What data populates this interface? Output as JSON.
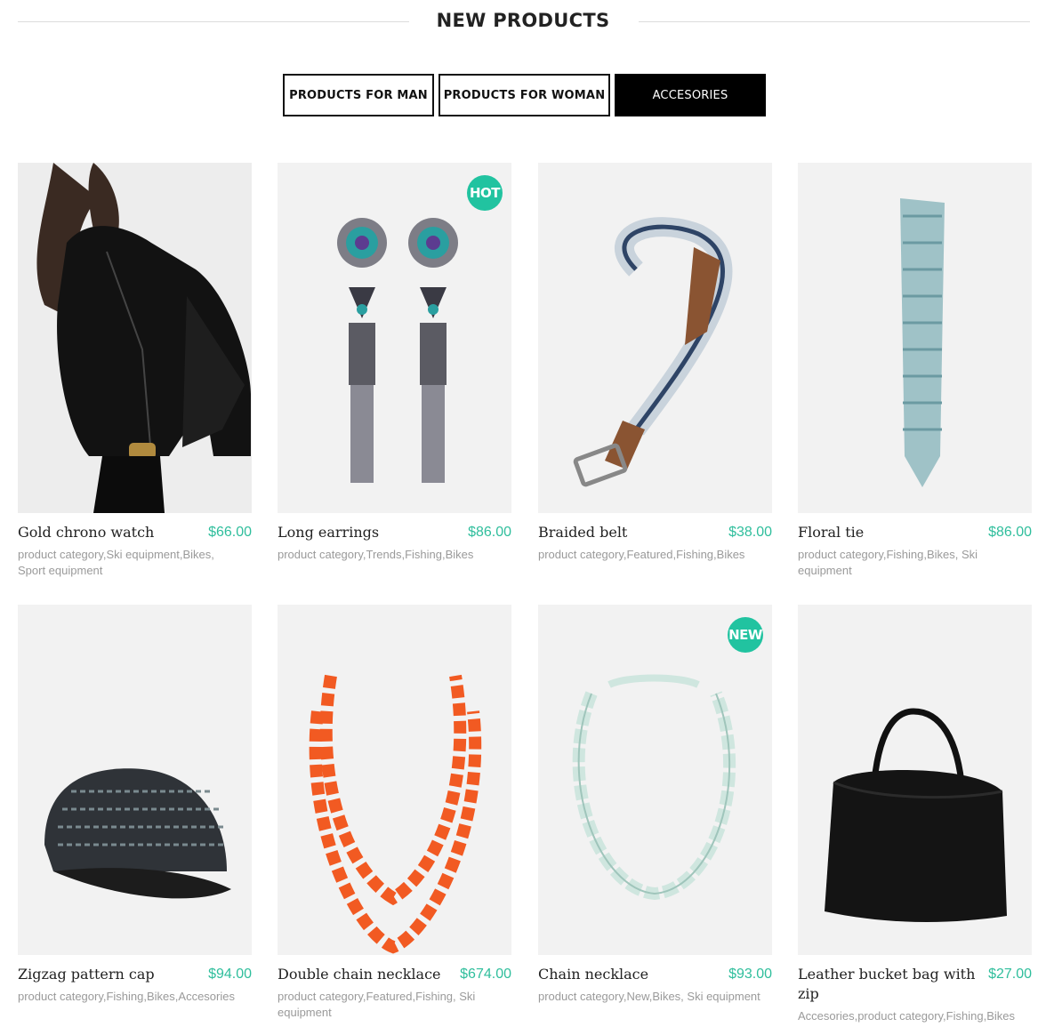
{
  "section": {
    "title": "NEW PRODUCTS"
  },
  "tabs": [
    {
      "label": "PRODUCTS FOR MAN",
      "active": false
    },
    {
      "label": "PRODUCTS FOR WOMAN",
      "active": false
    },
    {
      "label": "ACCESORIES",
      "active": true
    }
  ],
  "colors": {
    "accent": "#2fbe9c",
    "badge": "#21c3a0",
    "tab_active_bg": "#000000"
  },
  "products": [
    {
      "name": "Gold chrono watch",
      "price": "$66.00",
      "categories": "product category,Ski equipment,Bikes, Sport equipment",
      "badge": "",
      "image": "jacket-image"
    },
    {
      "name": "Long earrings",
      "price": "$86.00",
      "categories": "product category,Trends,Fishing,Bikes",
      "badge": "HOT",
      "image": "earrings-image"
    },
    {
      "name": "Braided belt",
      "price": "$38.00",
      "categories": "product category,Featured,Fishing,Bikes",
      "badge": "",
      "image": "belt-image"
    },
    {
      "name": "Floral tie",
      "price": "$86.00",
      "categories": "product category,Fishing,Bikes, Ski equipment",
      "badge": "",
      "image": "tie-image"
    },
    {
      "name": "Zigzag pattern cap",
      "price": "$94.00",
      "categories": "product category,Fishing,Bikes,Accesories",
      "badge": "",
      "image": "cap-image"
    },
    {
      "name": "Double chain necklace",
      "price": "$674.00",
      "categories": "product category,Featured,Fishing, Ski equipment",
      "badge": "",
      "image": "orange-necklace-image"
    },
    {
      "name": "Chain necklace",
      "price": "$93.00",
      "categories": "product category,New,Bikes, Ski equipment",
      "badge": "NEW",
      "image": "chain-necklace-image"
    },
    {
      "name": "Leather bucket bag with zip",
      "price": "$27.00",
      "categories": "Accesories,product category,Fishing,Bikes",
      "badge": "",
      "image": "bag-image"
    }
  ]
}
